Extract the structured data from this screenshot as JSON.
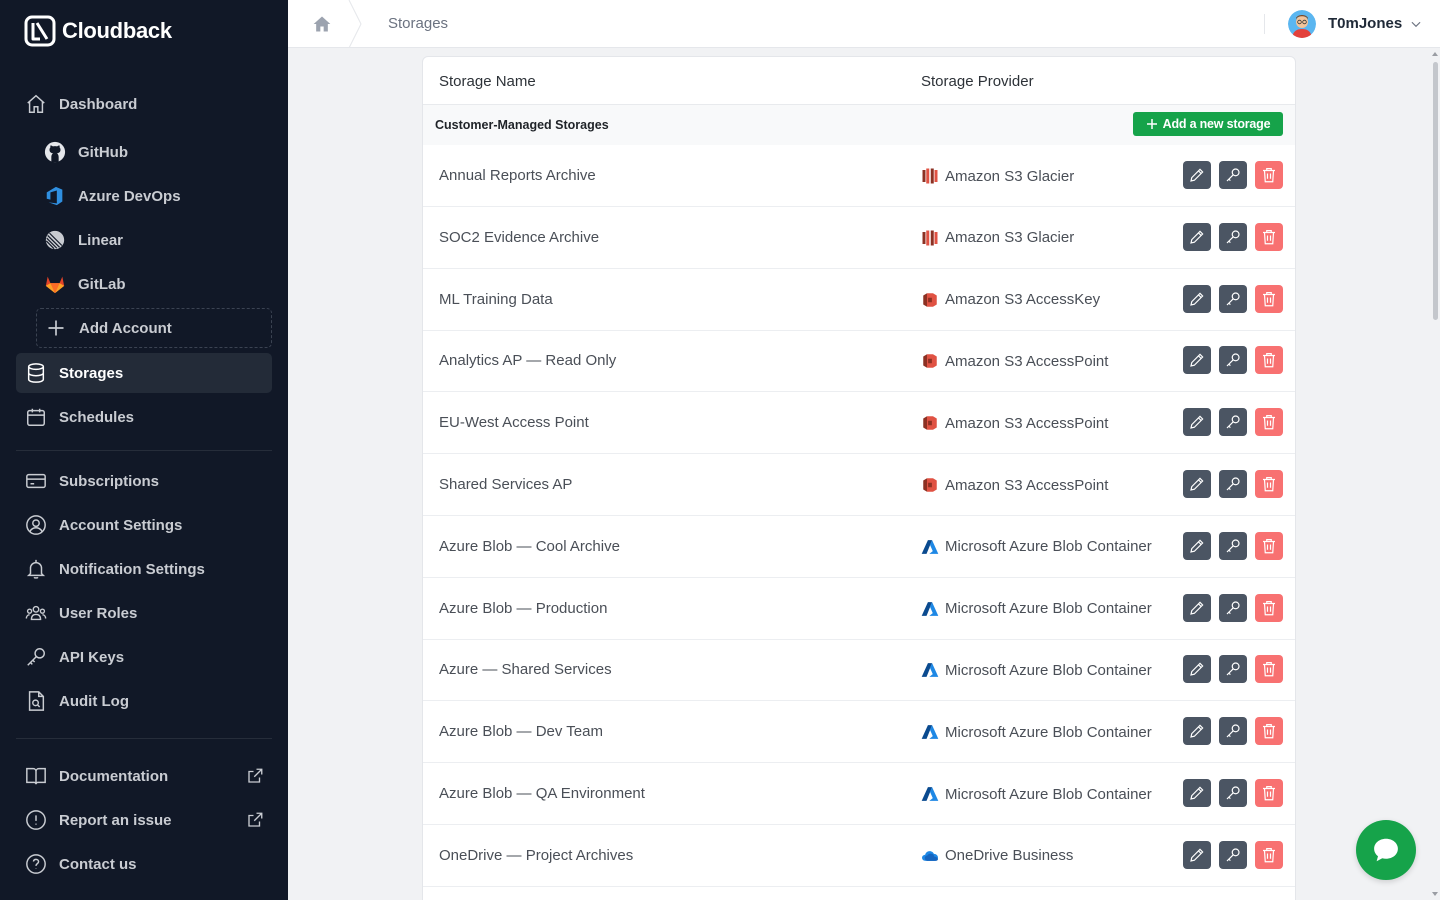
{
  "app": {
    "name": "Cloudback"
  },
  "sidebar": {
    "items": [
      {
        "label": "Dashboard",
        "icon": "home-icon"
      },
      {
        "label": "GitHub",
        "icon": "github-icon"
      },
      {
        "label": "Azure DevOps",
        "icon": "azure-devops-icon"
      },
      {
        "label": "Linear",
        "icon": "linear-icon"
      },
      {
        "label": "GitLab",
        "icon": "gitlab-icon"
      },
      {
        "label": "Add Account",
        "icon": "plus-icon"
      },
      {
        "label": "Storages",
        "icon": "database-icon"
      },
      {
        "label": "Schedules",
        "icon": "calendar-icon"
      },
      {
        "label": "Subscriptions",
        "icon": "credit-card-icon"
      },
      {
        "label": "Account Settings",
        "icon": "user-circle-icon"
      },
      {
        "label": "Notification Settings",
        "icon": "bell-icon"
      },
      {
        "label": "User Roles",
        "icon": "users-icon"
      },
      {
        "label": "API Keys",
        "icon": "key-icon"
      },
      {
        "label": "Audit Log",
        "icon": "audit-file-icon"
      },
      {
        "label": "Documentation",
        "icon": "book-icon"
      },
      {
        "label": "Report an issue",
        "icon": "alert-circle-icon"
      },
      {
        "label": "Contact us",
        "icon": "help-circle-icon"
      }
    ],
    "active": "Storages"
  },
  "header": {
    "breadcrumb": "Storages",
    "username": "T0mJones"
  },
  "table": {
    "columns": [
      "Storage Name",
      "Storage Provider"
    ],
    "section_title": "Customer-Managed Storages",
    "add_button_label": "Add a new storage",
    "rows": [
      {
        "name": "Annual Reports Archive",
        "provider": "Amazon S3 Glacier",
        "provider_icon": "s3-glacier-icon"
      },
      {
        "name": "SOC2 Evidence Archive",
        "provider": "Amazon S3 Glacier",
        "provider_icon": "s3-glacier-icon"
      },
      {
        "name": "ML Training Data",
        "provider": "Amazon S3 AccessKey",
        "provider_icon": "s3-icon"
      },
      {
        "name": "Analytics AP — Read Only",
        "provider": "Amazon S3 AccessPoint",
        "provider_icon": "s3-icon"
      },
      {
        "name": "EU-West Access Point",
        "provider": "Amazon S3 AccessPoint",
        "provider_icon": "s3-icon"
      },
      {
        "name": "Shared Services AP",
        "provider": "Amazon S3 AccessPoint",
        "provider_icon": "s3-icon"
      },
      {
        "name": "Azure Blob — Cool Archive",
        "provider": "Microsoft Azure Blob Container",
        "provider_icon": "azure-icon"
      },
      {
        "name": "Azure Blob — Production",
        "provider": "Microsoft Azure Blob Container",
        "provider_icon": "azure-icon"
      },
      {
        "name": "Azure — Shared Services",
        "provider": "Microsoft Azure Blob Container",
        "provider_icon": "azure-icon"
      },
      {
        "name": "Azure Blob — Dev Team",
        "provider": "Microsoft Azure Blob Container",
        "provider_icon": "azure-icon"
      },
      {
        "name": "Azure Blob — QA Environment",
        "provider": "Microsoft Azure Blob Container",
        "provider_icon": "azure-icon"
      },
      {
        "name": "OneDrive — Project Archives",
        "provider": "OneDrive Business",
        "provider_icon": "onedrive-icon"
      }
    ]
  },
  "colors": {
    "sidebar_bg": "#111827",
    "accent_green": "#16a34a",
    "edit_button": "#4b5563",
    "delete_button": "#f87171"
  }
}
